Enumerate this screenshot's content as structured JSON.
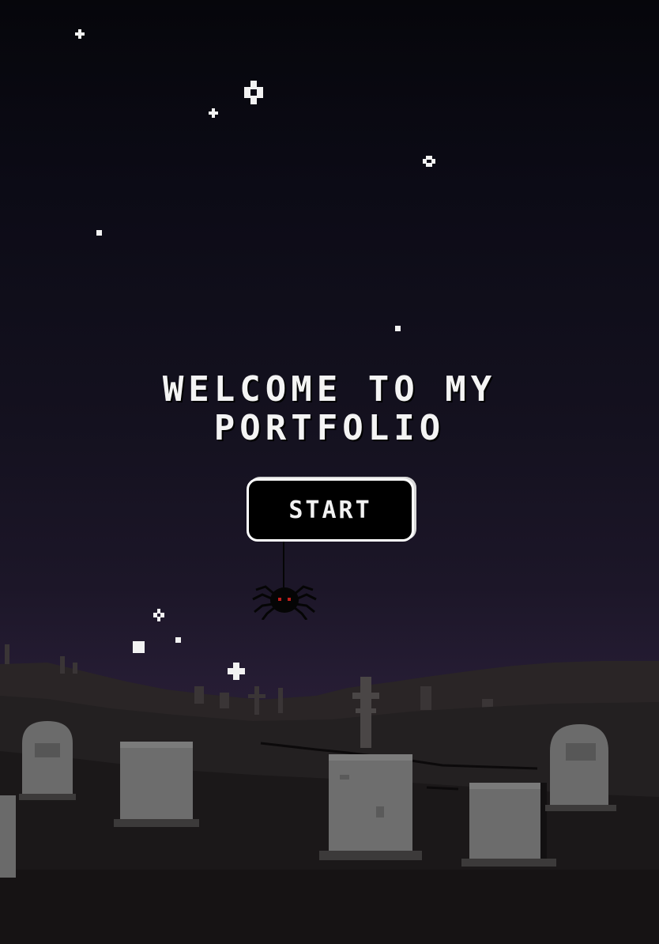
{
  "hero": {
    "title_line1": "WELCOME TO MY",
    "title_line2": "PORTFOLIO"
  },
  "start_button": {
    "label": "START"
  },
  "decor": {
    "spider_eye_color": "#c0201c",
    "star_color": "#f2f2f2",
    "tombstone_color": "#6b6b6b",
    "sky_top_color": "#06060b",
    "sky_horizon_color": "#2b2036",
    "ground_color": "#1a1719"
  }
}
